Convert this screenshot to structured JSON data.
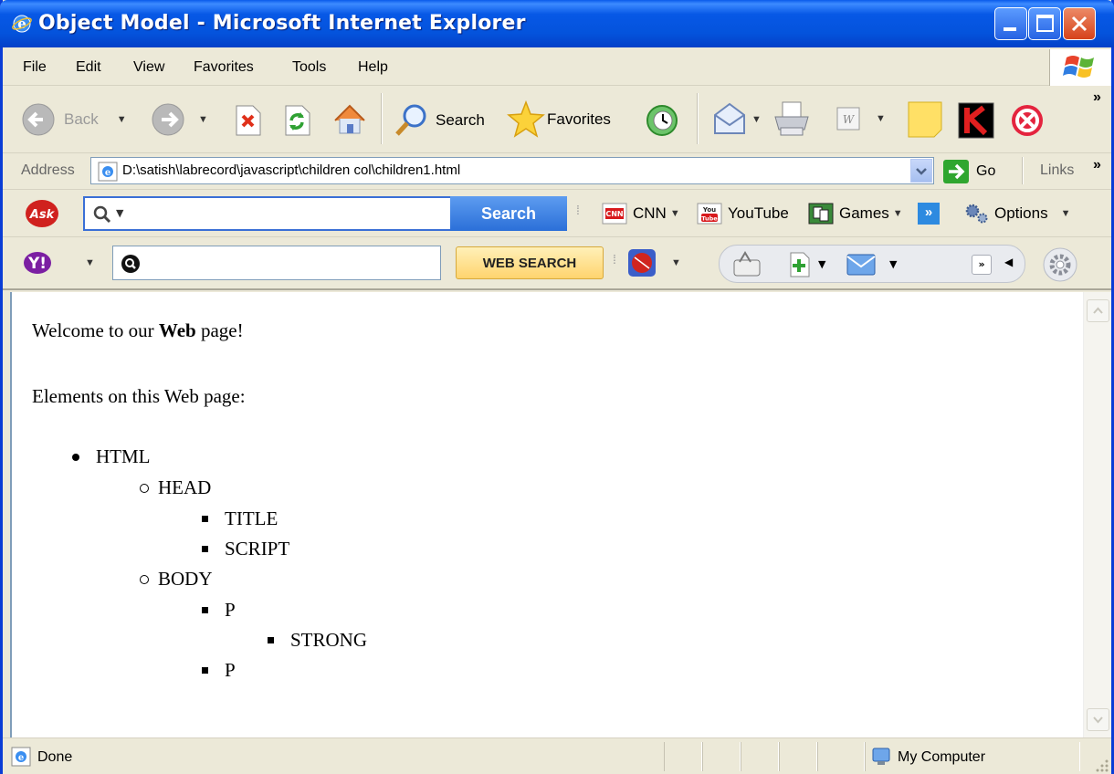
{
  "window": {
    "title": "Object Model - Microsoft Internet Explorer"
  },
  "menu": [
    "File",
    "Edit",
    "View",
    "Favorites",
    "Tools",
    "Help"
  ],
  "toolbar": {
    "back_label": "Back",
    "search_label": "Search",
    "favorites_label": "Favorites",
    "overflow": "»"
  },
  "address": {
    "label": "Address",
    "url": "D:\\satish\\labrecord\\javascript\\children col\\children1.html",
    "go_label": "Go",
    "links_label": "Links",
    "links_overflow": "»"
  },
  "ask_toolbar": {
    "logo": "Ask",
    "search_button": "Search",
    "cnn_label": "CNN",
    "youtube_label": "YouTube",
    "games_label": "Games",
    "overflow": "»",
    "options_label": "Options"
  },
  "yahoo_toolbar": {
    "logo": "Y!",
    "search_button": "WEB SEARCH",
    "overflow": "»"
  },
  "page": {
    "welcome_prefix": "Welcome to our ",
    "welcome_bold": "Web",
    "welcome_suffix": " page!",
    "elements_heading": "Elements on this Web page:",
    "tree": {
      "html": "HTML",
      "head": "HEAD",
      "title": "TITLE",
      "script": "SCRIPT",
      "body": "BODY",
      "p1": "P",
      "strong": "STRONG",
      "p2": "P"
    }
  },
  "status": {
    "text": "Done",
    "zone": "My Computer"
  },
  "colors": {
    "titlebar": "#0453dc",
    "chrome": "#ece9d8",
    "ask_search": "#2b6fd8",
    "yahoo_search": "#ffd46e"
  }
}
